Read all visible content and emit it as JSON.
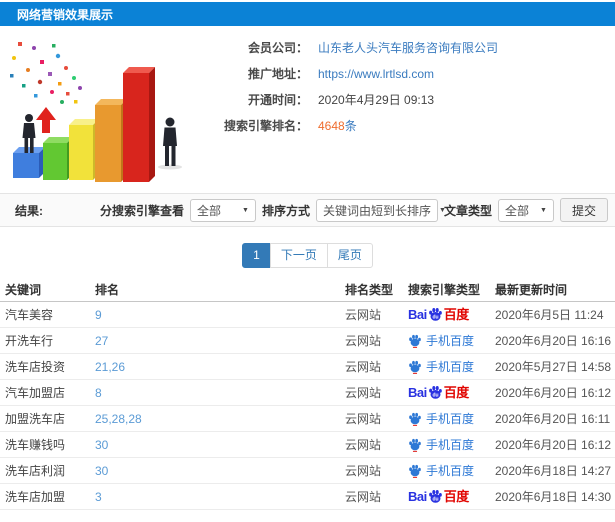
{
  "header": {
    "title": "网络营销效果展示"
  },
  "info": {
    "member_label": "会员公司：",
    "member_value": "山东老人头汽车服务咨询有限公司",
    "url_label": "推广地址：",
    "url_value": "https://www.lrtlsd.com",
    "open_label": "开通时间：",
    "open_value": "2020年4月29日 09:13",
    "rank_label": "搜索引擎排名：",
    "rank_count": "4648",
    "rank_unit": "条"
  },
  "filters": {
    "result_label": "结果:",
    "engine_view_label": "分搜索引擎查看",
    "engine_view_value": "全部",
    "sort_label": "排序方式",
    "sort_value": "关键词由短到长排序",
    "article_label": "文章类型",
    "article_value": "全部",
    "submit_label": "提交"
  },
  "icons": {
    "dropdown": "▼"
  },
  "pagination": {
    "current": "1",
    "next": "下一页",
    "last": "尾页"
  },
  "brand": {
    "bai": "Bai",
    "du": "du",
    "baidu": "百度",
    "mobile": "手机百度"
  },
  "colors": {
    "accent": "#0b82d6",
    "link": "#3a7bbf",
    "count": "#ef6c2d",
    "rank": "#5b9bd5",
    "baidu_blue": "#2932e1",
    "baidu_red": "#e10602",
    "mobile_blue": "#2d78d5"
  },
  "table": {
    "headers": {
      "keyword": "关键词",
      "rank": "排名",
      "rank_type": "排名类型",
      "engine": "搜索引擎类型",
      "updated": "最新更新时间"
    },
    "rows": [
      {
        "keyword": "汽车美容",
        "rank": "9",
        "rank_type": "云网站",
        "engine": "baidu",
        "updated": "2020年6月5日 11:24"
      },
      {
        "keyword": "开洗车行",
        "rank": "27",
        "rank_type": "云网站",
        "engine": "mobile",
        "updated": "2020年6月20日 16:16"
      },
      {
        "keyword": "洗车店投资",
        "rank": "21,26",
        "rank_type": "云网站",
        "engine": "mobile",
        "updated": "2020年5月27日 14:58"
      },
      {
        "keyword": "汽车加盟店",
        "rank": "8",
        "rank_type": "云网站",
        "engine": "baidu",
        "updated": "2020年6月20日 16:12"
      },
      {
        "keyword": "加盟洗车店",
        "rank": "25,28,28",
        "rank_type": "云网站",
        "engine": "mobile",
        "updated": "2020年6月20日 16:11"
      },
      {
        "keyword": "洗车赚钱吗",
        "rank": "30",
        "rank_type": "云网站",
        "engine": "mobile",
        "updated": "2020年6月20日 16:12"
      },
      {
        "keyword": "洗车店利润",
        "rank": "30",
        "rank_type": "云网站",
        "engine": "mobile",
        "updated": "2020年6月18日 14:27"
      },
      {
        "keyword": "洗车店加盟",
        "rank": "3",
        "rank_type": "云网站",
        "engine": "baidu",
        "updated": "2020年6月18日 14:30"
      }
    ]
  }
}
